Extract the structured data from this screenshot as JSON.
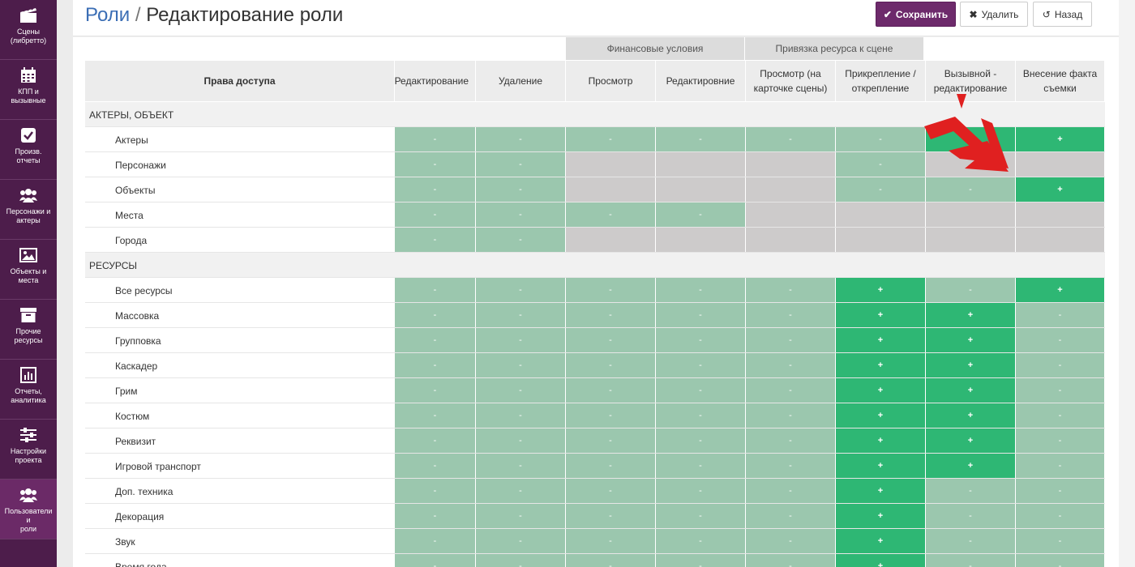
{
  "sidebar": {
    "items": [
      {
        "label": "Сцены\n(либретто)",
        "icon": "clapperboard-icon"
      },
      {
        "label": "КПП и\nвызывные",
        "icon": "calendar-icon"
      },
      {
        "label": "Произв.\nотчеты",
        "icon": "checkbox-icon"
      },
      {
        "label": "Персонажи и\nактеры",
        "icon": "users-icon"
      },
      {
        "label": "Объекты и\nместа",
        "icon": "image-icon"
      },
      {
        "label": "Прочие\nресурсы",
        "icon": "archive-icon"
      },
      {
        "label": "Отчеты,\nаналитика",
        "icon": "bar-chart-icon"
      },
      {
        "label": "Настройки\nпроекта",
        "icon": "sliders-icon"
      },
      {
        "label": "Пользователи и\nроли",
        "icon": "users-icon"
      }
    ]
  },
  "header": {
    "crumb": "Роли",
    "sep": "/",
    "title": "Редактирование роли",
    "save_label": "Сохранить",
    "delete_label": "Удалить",
    "back_label": "Назад"
  },
  "table": {
    "groups": [
      "Финансовые условия",
      "Привязка ресурса к сцене"
    ],
    "columns": [
      "Права доступа",
      "Редактирование",
      "Удаление",
      "Просмотр",
      "Редактировние",
      "Просмотр (на карточке сцены)",
      "Прикрепление / открепление",
      "Вызывной - редактирование",
      "Внесение факта съемки"
    ],
    "rows": [
      {
        "type": "section",
        "name": "АКТЕРЫ, ОБЪЕКТ"
      },
      {
        "type": "item",
        "name": "Актеры",
        "cells": [
          "g:-",
          "g:-",
          "g:-",
          "g:-",
          "g:-",
          "g:-",
          "G:+",
          "G:+"
        ]
      },
      {
        "type": "item",
        "name": "Персонажи",
        "cells": [
          "g:-",
          "g:-",
          "n:",
          "n:",
          "n:",
          "g:-",
          "n:",
          "n:"
        ]
      },
      {
        "type": "item",
        "name": "Объекты",
        "cells": [
          "g:-",
          "g:-",
          "n:",
          "n:",
          "n:",
          "g:-",
          "g:-",
          "G:+"
        ]
      },
      {
        "type": "item",
        "name": "Места",
        "cells": [
          "g:-",
          "g:-",
          "g:-",
          "g:-",
          "n:",
          "n:",
          "n:",
          "n:"
        ]
      },
      {
        "type": "item",
        "name": "Города",
        "cells": [
          "g:-",
          "g:-",
          "n:",
          "n:",
          "n:",
          "n:",
          "n:",
          "n:"
        ]
      },
      {
        "type": "section",
        "name": "РЕСУРСЫ"
      },
      {
        "type": "item",
        "name": "Все ресурсы",
        "cells": [
          "g:-",
          "g:-",
          "g:-",
          "g:-",
          "g:-",
          "G:+",
          "g:-",
          "G:+"
        ]
      },
      {
        "type": "item",
        "name": "Массовка",
        "cells": [
          "g:-",
          "g:-",
          "g:-",
          "g:-",
          "g:-",
          "G:+",
          "G:+",
          "g:-"
        ]
      },
      {
        "type": "item",
        "name": "Групповка",
        "cells": [
          "g:-",
          "g:-",
          "g:-",
          "g:-",
          "g:-",
          "G:+",
          "G:+",
          "g:-"
        ]
      },
      {
        "type": "item",
        "name": "Каскадер",
        "cells": [
          "g:-",
          "g:-",
          "g:-",
          "g:-",
          "g:-",
          "G:+",
          "G:+",
          "g:-"
        ]
      },
      {
        "type": "item",
        "name": "Грим",
        "cells": [
          "g:-",
          "g:-",
          "g:-",
          "g:-",
          "g:-",
          "G:+",
          "G:+",
          "g:-"
        ]
      },
      {
        "type": "item",
        "name": "Костюм",
        "cells": [
          "g:-",
          "g:-",
          "g:-",
          "g:-",
          "g:-",
          "G:+",
          "G:+",
          "g:-"
        ]
      },
      {
        "type": "item",
        "name": "Реквизит",
        "cells": [
          "g:-",
          "g:-",
          "g:-",
          "g:-",
          "g:-",
          "G:+",
          "G:+",
          "g:-"
        ]
      },
      {
        "type": "item",
        "name": "Игровой транспорт",
        "cells": [
          "g:-",
          "g:-",
          "g:-",
          "g:-",
          "g:-",
          "G:+",
          "G:+",
          "g:-"
        ]
      },
      {
        "type": "item",
        "name": "Доп. техника",
        "cells": [
          "g:-",
          "g:-",
          "g:-",
          "g:-",
          "g:-",
          "G:+",
          "g:-",
          "g:-"
        ]
      },
      {
        "type": "item",
        "name": "Декорация",
        "cells": [
          "g:-",
          "g:-",
          "g:-",
          "g:-",
          "g:-",
          "G:+",
          "g:-",
          "g:-"
        ]
      },
      {
        "type": "item",
        "name": "Звук",
        "cells": [
          "g:-",
          "g:-",
          "g:-",
          "g:-",
          "g:-",
          "G:+",
          "g:-",
          "g:-"
        ]
      },
      {
        "type": "item",
        "name": "Время года",
        "cells": [
          "g:-",
          "g:-",
          "g:-",
          "g:-",
          "g:-",
          "G:+",
          "g:-",
          "g:-"
        ]
      }
    ]
  },
  "colors": {
    "sidebar": "#4d1d4b",
    "allowed_inherited": "#9bc7ae",
    "allowed": "#2eb774",
    "not_applicable": "#cdcbcb",
    "annotation_arrow": "#e02020"
  }
}
